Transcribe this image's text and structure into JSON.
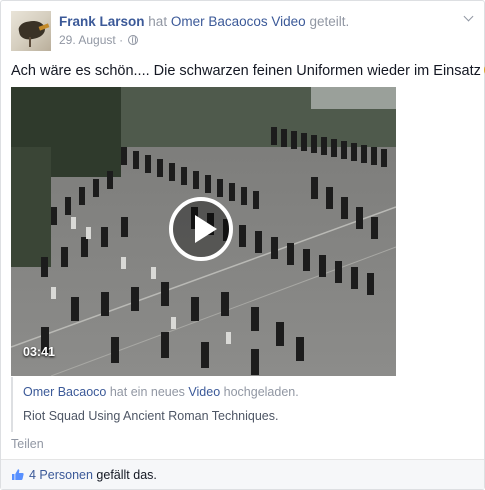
{
  "post": {
    "author": "Frank Larson",
    "action_prefix": "hat",
    "shared_from": "Omer Bacaocos Video",
    "action_suffix": "geteilt.",
    "date": "29. August",
    "separator": "·",
    "message": "Ach wäre es schön.... Die schwarzen feinen Uniformen wieder im Einsatz",
    "message_emoji": "smiley-icon"
  },
  "video": {
    "duration": "03:41",
    "play_icon": "play-icon"
  },
  "shared": {
    "source_name": "Omer Bacaoco",
    "text_middle": "hat ein neues",
    "video_word": "Video",
    "text_end": "hochgeladen.",
    "video_title": "Riot Squad Using Ancient Roman Techniques."
  },
  "actions": {
    "share": "Teilen"
  },
  "likes": {
    "count_text": "4 Personen",
    "suffix": "gefällt das.",
    "icon": "thumbs-up-icon"
  },
  "colors": {
    "link": "#3b5998",
    "muted": "#9197a3",
    "likes_bg": "#f6f7f9"
  }
}
